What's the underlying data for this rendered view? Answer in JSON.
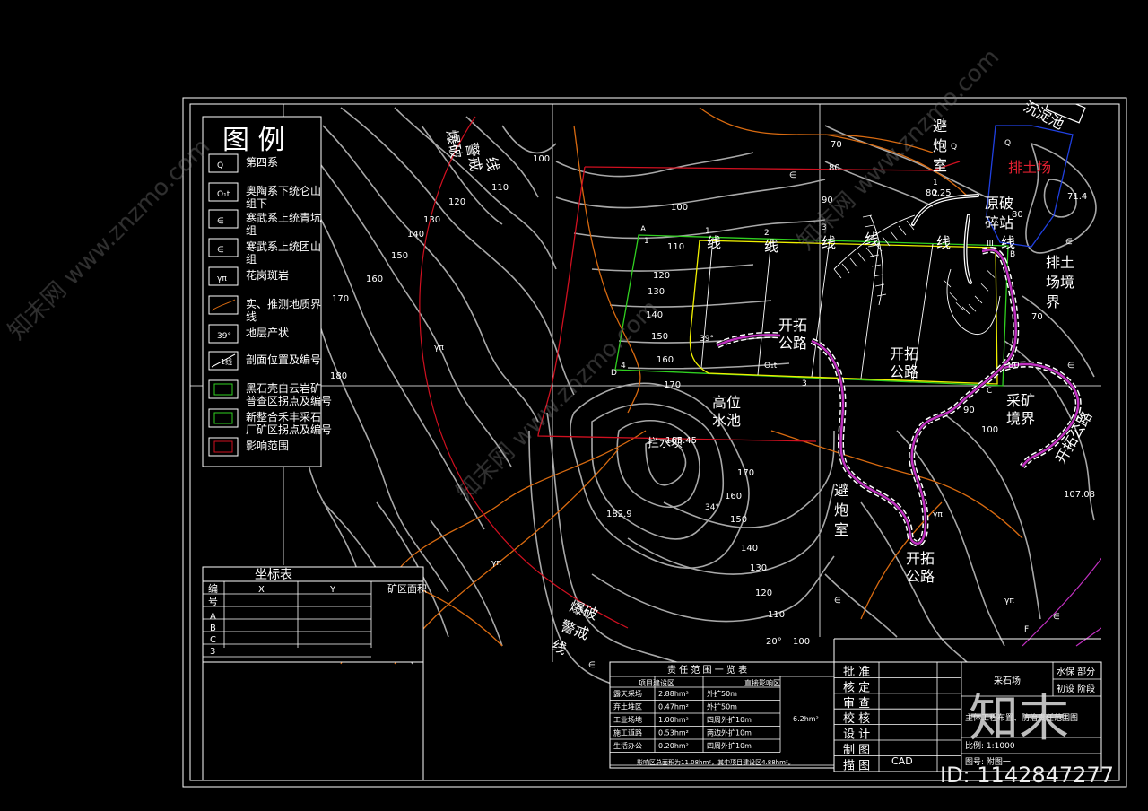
{
  "legend": {
    "title": "图 例",
    "items": [
      {
        "symbol": "Q",
        "label": "第四系"
      },
      {
        "symbol": "O₁t",
        "label": "奥陶系下统仑山组下"
      },
      {
        "symbol": "∈",
        "label": "寒武系上统青坑组"
      },
      {
        "symbol": "∈",
        "label": "寒武系上统团山组"
      },
      {
        "symbol": "γπ",
        "label": "花岗斑岩"
      },
      {
        "symbol": "",
        "label": "实、推测地质界线"
      },
      {
        "symbol": "39°",
        "label": "地层产状"
      },
      {
        "symbol": "1线",
        "label": "剖面位置及编号"
      },
      {
        "symbol": "",
        "label": "黑石壳白云岩矿普查区拐点及编号"
      },
      {
        "symbol": "",
        "label": "新整合禾丰采石厂矿区拐点及编号"
      },
      {
        "symbol": "",
        "label": "影响范围"
      }
    ]
  },
  "coord_table": {
    "title": "坐标表",
    "headers": [
      "编号",
      "X",
      "Y",
      "矿区面积"
    ],
    "rows": [
      "A",
      "B",
      "C",
      "3"
    ]
  },
  "responsibility_table": {
    "title": "责 任 范 围 一 览 表",
    "headers": [
      "项目建设区",
      "直接影响区"
    ],
    "rows": [
      {
        "name": "露天采场",
        "area": "2.88hm²",
        "impact": "外扩50m"
      },
      {
        "name": "弃土堆区",
        "area": "0.47hm²",
        "impact": "外扩50m"
      },
      {
        "name": "工业场地",
        "area": "1.00hm²",
        "impact": "四周外扩10m"
      },
      {
        "name": "施工道路",
        "area": "0.53hm²",
        "impact": "两边外扩10m"
      },
      {
        "name": "生活办公",
        "area": "0.20hm²",
        "impact": "四周外扩10m"
      }
    ],
    "total": "6.2hm²",
    "footnote": "影响区总面积为11.08hm²，其中项目建设区4.88hm²。"
  },
  "title_block": {
    "roles": [
      "批 准",
      "核 定",
      "审 查",
      "校 核",
      "设 计",
      "制 图",
      "描 图"
    ],
    "project": "采石场",
    "part": "水保 部分",
    "stage": "初设 阶段",
    "drawing_title": "主体工程布置、防治责任范围图",
    "scale": "比例: 1:1000",
    "drawing_no": "图号: 附图一",
    "cad": "CAD"
  },
  "map_labels": {
    "blast_warning": "爆破警戒线",
    "blast_warning_2": "爆破警戒线",
    "shelter_1": "避炮室",
    "shelter_2": "避炮室",
    "sediment_pool": "沉淀池",
    "dump_site": "排土场",
    "dump_boundary": "排土场境界",
    "crusher": "原破碎站",
    "road_1": "开拓公路",
    "road_2": "开拓公路",
    "road_3": "开拓公路",
    "road_4": "开拓公路",
    "high_pool": "高位水池",
    "mining_boundary": "采矿境界",
    "fence": "拦水坝",
    "line_label": "线",
    "elev_1": "182.9",
    "elev_2": "107.08",
    "elev_3": "165.45",
    "elev_4": "80.25",
    "elev_5": "71.4"
  },
  "contour_values": [
    "100",
    "110",
    "120",
    "130",
    "140",
    "150",
    "160",
    "170",
    "180",
    "90",
    "80",
    "70"
  ],
  "colors": {
    "contour": "#a8a8a8",
    "influence": "#d01020",
    "geology": "#d86a10",
    "survey": "#f0f000",
    "mine": "#30d020",
    "road": "#c030c0",
    "dump": "#2040e0",
    "frame": "#ffffff"
  },
  "watermark": {
    "site": "知末网 www.znzmo.com",
    "logo": "知末",
    "id": "ID: 1142847277"
  }
}
